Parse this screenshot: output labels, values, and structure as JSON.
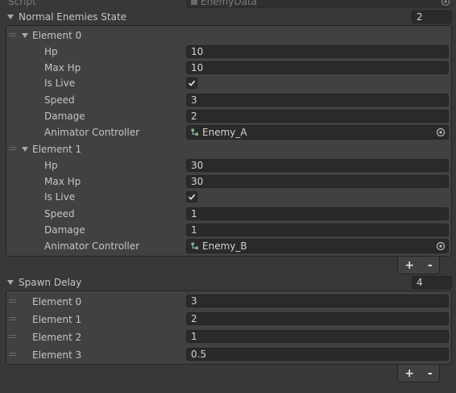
{
  "script_row": {
    "label": "Script",
    "value": "EnemyData"
  },
  "normal_enemies": {
    "label": "Normal Enemies State",
    "size": "2",
    "elements": [
      {
        "title": "Element 0",
        "fields": {
          "hp_label": "Hp",
          "hp": "10",
          "maxhp_label": "Max Hp",
          "maxhp": "10",
          "islive_label": "Is Live",
          "islive": true,
          "speed_label": "Speed",
          "speed": "3",
          "damage_label": "Damage",
          "damage": "2",
          "anim_label": "Animator Controller",
          "anim": "Enemy_A"
        }
      },
      {
        "title": "Element 1",
        "fields": {
          "hp_label": "Hp",
          "hp": "30",
          "maxhp_label": "Max Hp",
          "maxhp": "30",
          "islive_label": "Is Live",
          "islive": true,
          "speed_label": "Speed",
          "speed": "1",
          "damage_label": "Damage",
          "damage": "1",
          "anim_label": "Animator Controller",
          "anim": "Enemy_B"
        }
      }
    ],
    "add_label": "+",
    "remove_label": "-"
  },
  "spawn_delay": {
    "label": "Spawn Delay",
    "size": "4",
    "elements": [
      {
        "label": "Element 0",
        "value": "3"
      },
      {
        "label": "Element 1",
        "value": "2"
      },
      {
        "label": "Element 2",
        "value": "1"
      },
      {
        "label": "Element 3",
        "value": "0.5"
      }
    ],
    "add_label": "+",
    "remove_label": "-"
  }
}
